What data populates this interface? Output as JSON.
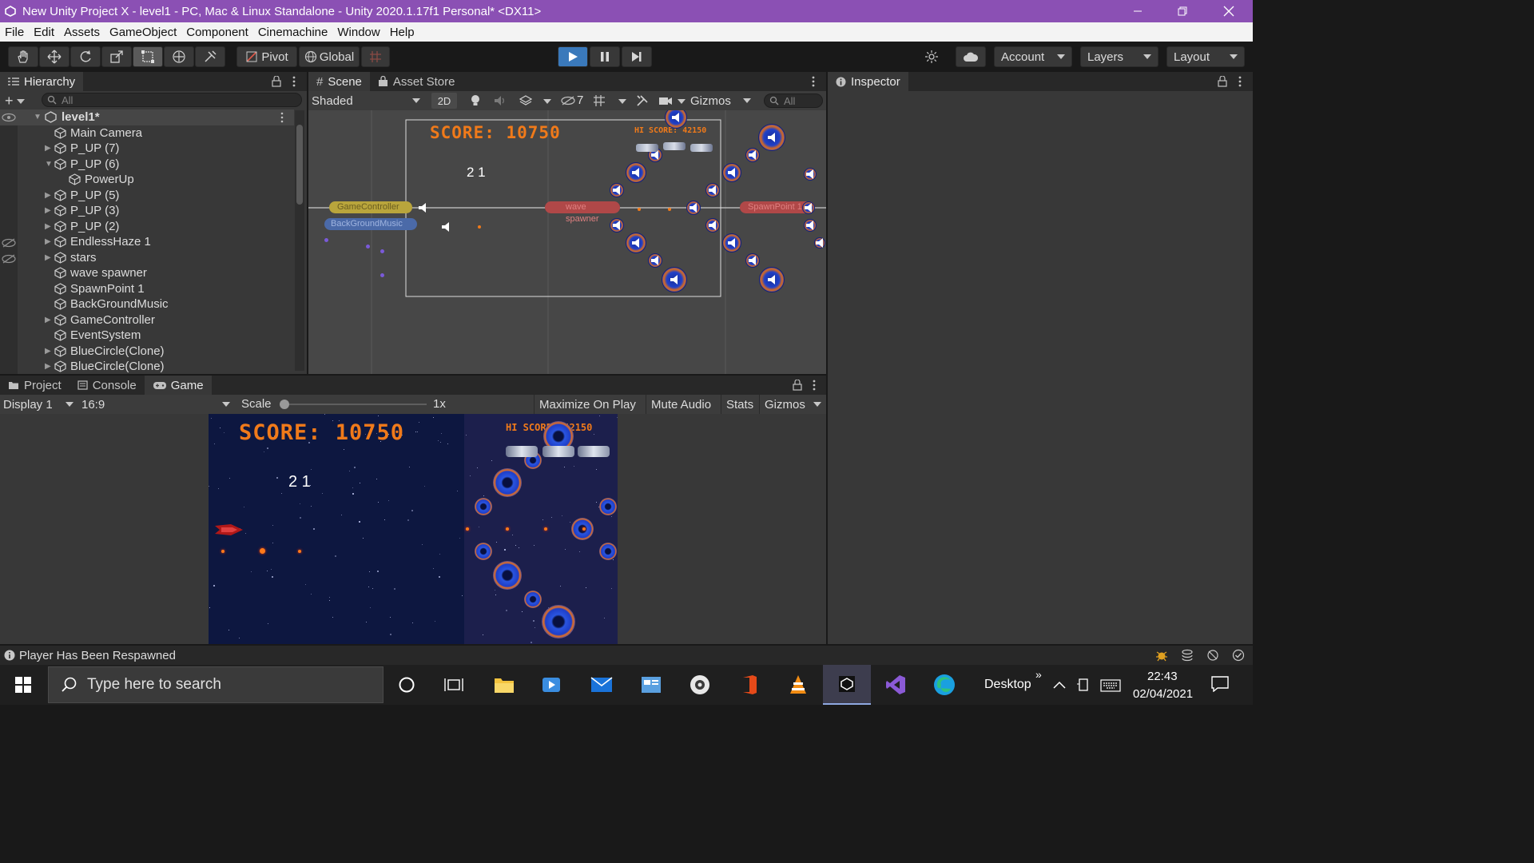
{
  "window": {
    "title": "New Unity Project X - level1 - PC, Mac & Linux Standalone - Unity 2020.1.17f1 Personal* <DX11>"
  },
  "menu": [
    "File",
    "Edit",
    "Assets",
    "GameObject",
    "Component",
    "Cinemachine",
    "Window",
    "Help"
  ],
  "toolbar": {
    "pivot": "Pivot",
    "global": "Global",
    "account": "Account",
    "layers": "Layers",
    "layout": "Layout"
  },
  "hierarchy": {
    "tab": "Hierarchy",
    "search_placeholder": "All",
    "scene": "level1*",
    "items": [
      {
        "label": "Main Camera",
        "indent": 1,
        "fold": ""
      },
      {
        "label": "P_UP (7)",
        "indent": 1,
        "fold": "right"
      },
      {
        "label": "P_UP (6)",
        "indent": 1,
        "fold": "down"
      },
      {
        "label": "PowerUp",
        "indent": 2,
        "fold": ""
      },
      {
        "label": "P_UP (5)",
        "indent": 1,
        "fold": "right"
      },
      {
        "label": "P_UP (3)",
        "indent": 1,
        "fold": "right"
      },
      {
        "label": "P_UP (2)",
        "indent": 1,
        "fold": "right"
      },
      {
        "label": "EndlessHaze 1",
        "indent": 1,
        "fold": "right"
      },
      {
        "label": "stars",
        "indent": 1,
        "fold": "right"
      },
      {
        "label": "wave spawner",
        "indent": 1,
        "fold": ""
      },
      {
        "label": "SpawnPoint 1",
        "indent": 1,
        "fold": ""
      },
      {
        "label": "BackGroundMusic",
        "indent": 1,
        "fold": ""
      },
      {
        "label": "GameController",
        "indent": 1,
        "fold": "right"
      },
      {
        "label": "EventSystem",
        "indent": 1,
        "fold": ""
      },
      {
        "label": "BlueCircle(Clone)",
        "indent": 1,
        "fold": "right"
      },
      {
        "label": "BlueCircle(Clone)",
        "indent": 1,
        "fold": "right"
      }
    ]
  },
  "scene": {
    "tabs": [
      "Scene",
      "Asset Store"
    ],
    "shading": "Shaded",
    "mode_2d": "2D",
    "hidden_count": "7",
    "gizmos": "Gizmos",
    "search_placeholder": "All",
    "score": "SCORE: 10750",
    "hiscore": "HI SCORE: 42150",
    "lives": "2 1",
    "label_gamecontroller": "GameController",
    "label_bgmusic": "BackGroundMusic",
    "label_wavespawner": "wave spawner",
    "label_spawnpoint": "SpawnPoint 1"
  },
  "bottom_tabs": [
    "Project",
    "Console",
    "Game"
  ],
  "game": {
    "display": "Display 1",
    "aspect": "16:9",
    "scale_label": "Scale",
    "scale_value": "1x",
    "maximize": "Maximize On Play",
    "mute": "Mute Audio",
    "stats": "Stats",
    "gizmos": "Gizmos",
    "score": "SCORE: 10750",
    "hiscore": "HI SCORE: 42150",
    "lives": "2 1"
  },
  "inspector": {
    "tab": "Inspector"
  },
  "status": {
    "message": "Player Has Been Respawned"
  },
  "taskbar": {
    "search_placeholder": "Type here to search",
    "desktop": "Desktop",
    "time": "22:43",
    "date": "02/04/2021"
  },
  "colors": {
    "title_bar": "#8b50b4",
    "play_active": "#3a79bb",
    "score_orange": "#f07a1a"
  }
}
